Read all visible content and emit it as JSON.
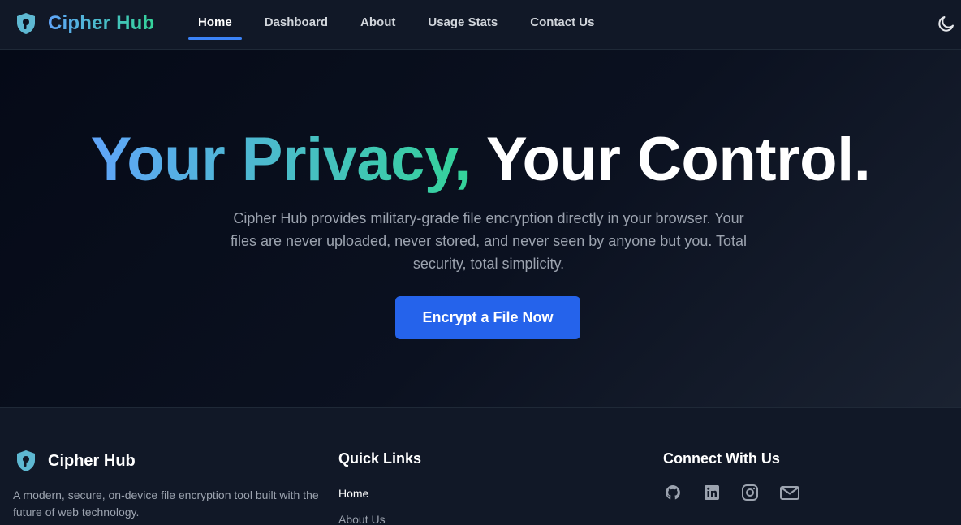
{
  "nav": {
    "brand": "Cipher Hub",
    "links": [
      "Home",
      "Dashboard",
      "About",
      "Usage Stats",
      "Contact Us"
    ],
    "active": "Home"
  },
  "hero": {
    "title_part1": "Your Privacy,",
    "title_part2": "Your Control.",
    "description": "Cipher Hub provides military-grade file encryption directly in your browser. Your files are never uploaded, never stored, and never seen by anyone but you. Total security, total simplicity.",
    "cta": "Encrypt a File Now"
  },
  "footer": {
    "brand": "Cipher Hub",
    "description": "A modern, secure, on-device file encryption tool built with the future of web technology.",
    "quick_links_title": "Quick Links",
    "quick_links": [
      "Home",
      "About Us"
    ],
    "connect_title": "Connect With Us",
    "social_icons": [
      "github-icon",
      "linkedin-icon",
      "instagram-icon",
      "mail-icon"
    ]
  },
  "colors": {
    "accent": "#2563eb",
    "gradient_start": "#60a5fa",
    "gradient_end": "#34d399",
    "background": "#0b1120"
  }
}
